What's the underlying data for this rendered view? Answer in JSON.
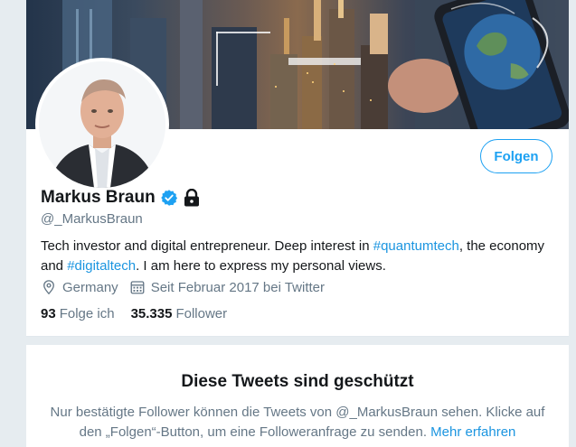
{
  "profile": {
    "name": "Markus Braun",
    "handle": "@_MarkusBraun",
    "follow_label": "Folgen",
    "bio": {
      "part1": "Tech investor and digital entrepreneur. Deep interest in ",
      "hashtag1": "#quantumtech",
      "part2": ", the economy and ",
      "hashtag2": "#digitaltech",
      "part3": ". I am here to express my personal views."
    },
    "location": "Germany",
    "joined": "Seit Februar 2017 bei Twitter",
    "stats": {
      "following_count": "93",
      "following_label": "Folge ich",
      "followers_count": "35.335",
      "followers_label": "Follower"
    },
    "icons": {
      "verified": "verified-badge-icon",
      "protected": "lock-icon",
      "location": "location-pin-icon",
      "joined": "calendar-icon"
    }
  },
  "protected_notice": {
    "title": "Diese Tweets sind geschützt",
    "text": "Nur bestätigte Follower können die Tweets von @_MarkusBraun sehen. Klicke auf den „Folgen“-Button, um eine Followeranfrage zu senden. ",
    "link": "Mehr erfahren"
  },
  "colors": {
    "accent": "#1da1f2",
    "link": "#1b95e0",
    "secondary_text": "#657786",
    "background": "#e6ecf0"
  }
}
